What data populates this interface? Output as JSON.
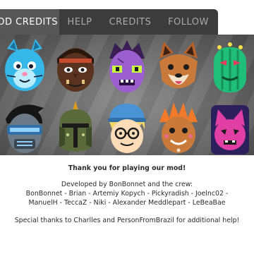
{
  "tabs": {
    "mod_credits": "OD CREDITS",
    "help": "HELP",
    "credits": "CREDITS",
    "follow": "FOLLOW"
  },
  "gallery": {
    "avatars": [
      "blue-bunny-avatar",
      "brown-tribal-avatar",
      "purple-zombie-avatar",
      "fox-avatar",
      "green-cactus-avatar",
      "black-hair-visor-avatar",
      "green-knight-avatar",
      "blonde-cap-avatar",
      "gingerbread-avatar",
      "pink-cat-avatar"
    ]
  },
  "credits": {
    "title": "Thank you for playing our mod!",
    "developed_by": "Developed by BonBonnet and the crew:",
    "crew_line1": "BonBonnet - Brian - Artemiy Kopych - Pickyradish - Joelnc02 -",
    "crew_line2": "ManuelH - TeccaZ - Niki - Alexander Meddlepart - LeBeaBae",
    "thanks": "Special thanks to Charlles and PersonFromBrazil for additional help!"
  },
  "colors": {
    "tabbar": "#3c3c3c",
    "tab_active": "#575757",
    "tab_text_inactive": "#a9a9a9",
    "tab_text_active": "#ffffff",
    "gallery_bg": "#6e6e6e",
    "credits_text": "#2b2b2b"
  }
}
